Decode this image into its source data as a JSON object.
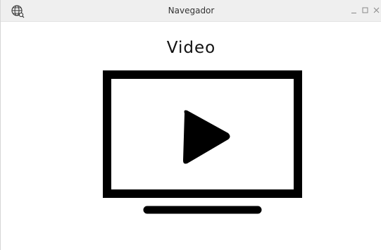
{
  "window": {
    "title": "Navegador",
    "globe_icon": "globe-icon",
    "controls": {
      "minimize": "minimize-icon",
      "maximize": "maximize-icon",
      "close": "close-icon"
    }
  },
  "main": {
    "heading": "Video",
    "illustration": "video-play-icon"
  },
  "colors": {
    "titlebar": "#efefef",
    "foreground": "#000000",
    "background": "#ffffff"
  }
}
